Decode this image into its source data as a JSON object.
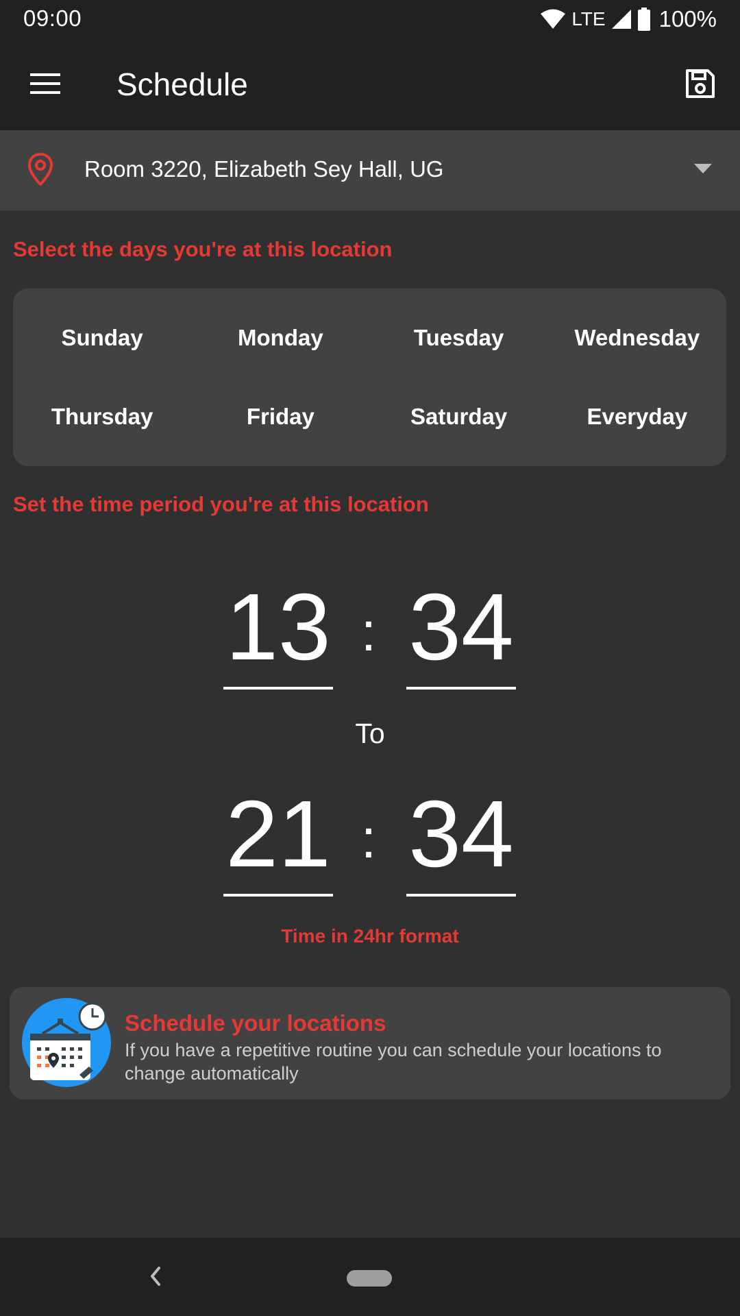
{
  "status_bar": {
    "time": "09:00",
    "network": "LTE",
    "battery": "100%"
  },
  "app_bar": {
    "title": "Schedule",
    "menu_icon": "hamburger-menu-icon",
    "save_icon": "save-icon"
  },
  "location": {
    "selected": "Room 3220, Elizabeth Sey Hall, UG",
    "icon": "location-pin-icon"
  },
  "days_section": {
    "heading": "Select the days you're at this location",
    "days": [
      "Sunday",
      "Monday",
      "Tuesday",
      "Wednesday",
      "Thursday",
      "Friday",
      "Saturday",
      "Everyday"
    ]
  },
  "time_section": {
    "heading": "Set the time period you're at this location",
    "start_hour": "13",
    "start_minute": "34",
    "separator": ":",
    "to_label": "To",
    "end_hour": "21",
    "end_minute": "34",
    "format_hint": "Time in 24hr format"
  },
  "info_card": {
    "title": "Schedule your locations",
    "body": "If you have a repetitive routine you can schedule your locations to change automatically"
  },
  "colors": {
    "accent": "#e53935",
    "background": "#303030",
    "bar": "#212121",
    "surface": "#424242"
  }
}
